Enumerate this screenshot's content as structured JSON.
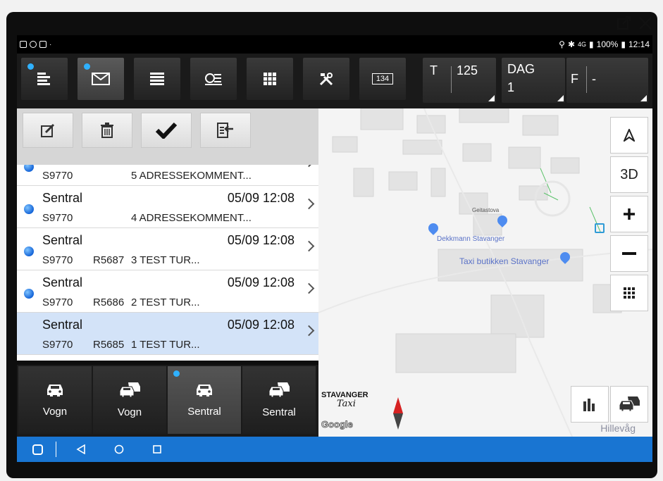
{
  "status": {
    "right_text": "100%",
    "time": "12:14",
    "network_label": "4G"
  },
  "toolbar": {
    "trip_label": "T",
    "trip_value": "125",
    "day_label": "DAG",
    "day_value": "1",
    "shift_label": "F",
    "shift_value": "-",
    "meter_badge": "134"
  },
  "messages": [
    {
      "from": "",
      "time": "",
      "car": "S9770",
      "ref": "",
      "text": "5 ADRESSEKOMMENT..."
    },
    {
      "from": "Sentral",
      "time": "05/09 12:08",
      "car": "S9770",
      "ref": "",
      "text": "4 ADRESSEKOMMENT..."
    },
    {
      "from": "Sentral",
      "time": "05/09 12:08",
      "car": "S9770",
      "ref": "R5687",
      "text": "3 TEST TUR..."
    },
    {
      "from": "Sentral",
      "time": "05/09 12:08",
      "car": "S9770",
      "ref": "R5686",
      "text": "2 TEST TUR..."
    },
    {
      "from": "Sentral",
      "time": "05/09 12:08",
      "car": "S9770",
      "ref": "R5685",
      "text": "1 TEST TUR..."
    }
  ],
  "tabs": [
    {
      "label": "Vogn"
    },
    {
      "label": "Vogn"
    },
    {
      "label": "Sentral"
    },
    {
      "label": "Sentral"
    }
  ],
  "map": {
    "poi_1": "Geitastova",
    "poi_2": "Dekkmann Stavanger",
    "poi_3": "Taxi butikken Stavanger",
    "area": "Hillevåg",
    "logo_line1": "STAVANGER",
    "logo_line2": "Taxi",
    "google": "Google",
    "btn_3d": "3D"
  },
  "colors": {
    "accent": "#2fb1ff",
    "navbar": "#1975d2",
    "selected_row": "#d3e3f8",
    "toolbar": "#1a1a1a"
  }
}
